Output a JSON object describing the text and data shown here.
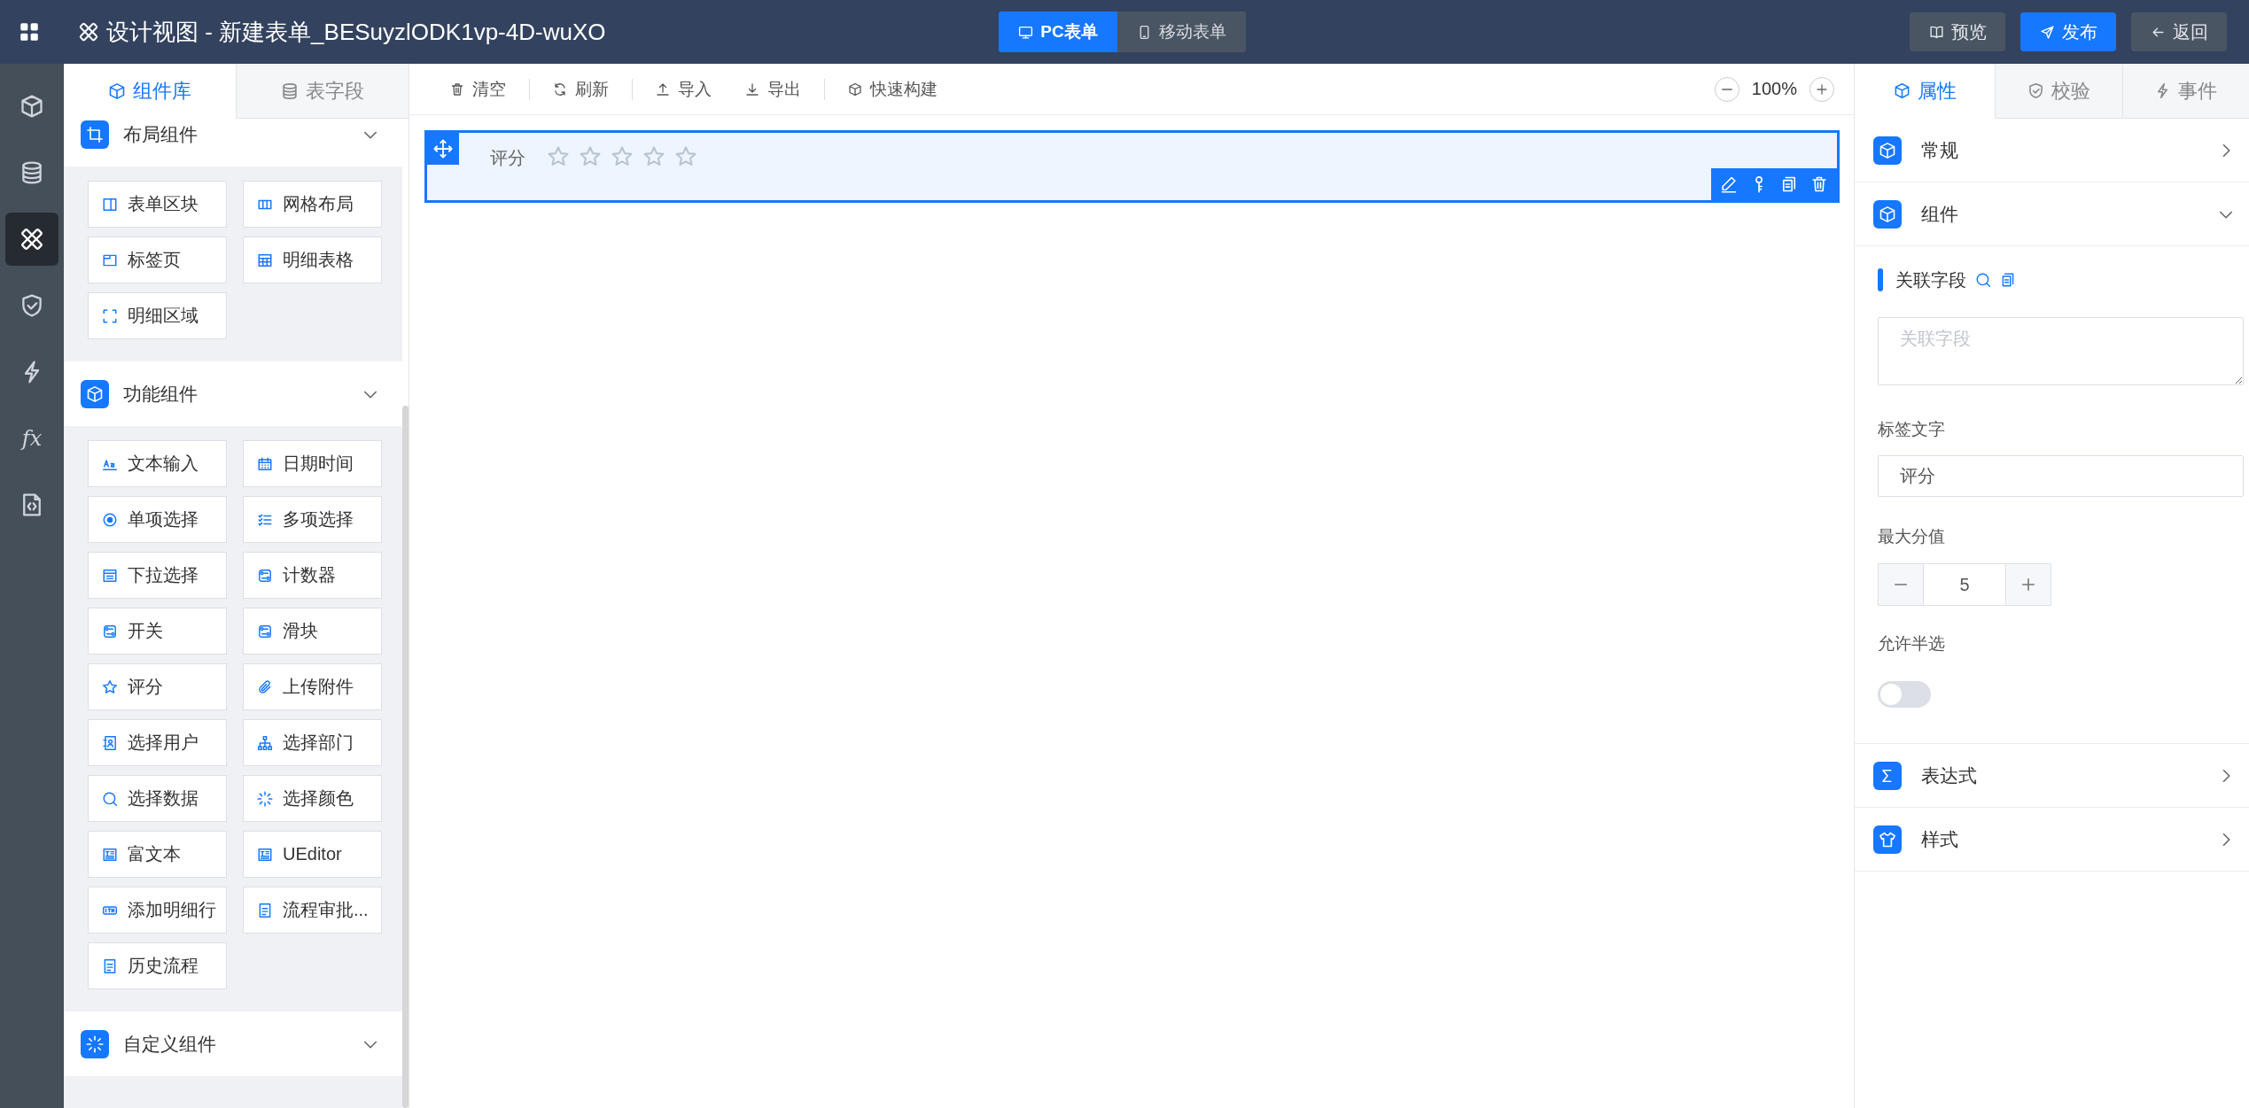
{
  "top_bar": {
    "title": "设计视图 - 新建表单_BESuyzlODK1vp-4D-wuXO",
    "mode_tabs": [
      {
        "label": "PC表单",
        "selected": true
      },
      {
        "label": "移动表单",
        "selected": false
      }
    ],
    "actions": [
      {
        "label": "预览",
        "kind": "secondary"
      },
      {
        "label": "发布",
        "kind": "primary"
      },
      {
        "label": "返回",
        "kind": "secondary"
      }
    ]
  },
  "rail": [
    {
      "selected": false
    },
    {
      "selected": false
    },
    {
      "selected": true
    },
    {
      "selected": false
    },
    {
      "selected": false
    },
    {
      "selected": false,
      "glyph": "fx"
    },
    {
      "selected": false
    }
  ],
  "left_panel": {
    "tabs": [
      {
        "label": "组件库",
        "selected": true
      },
      {
        "label": "表字段",
        "selected": false
      }
    ],
    "sections": [
      {
        "title": "布局组件",
        "expanded": true,
        "items": [
          "表单区块",
          "网格布局",
          "标签页",
          "明细表格",
          "明细区域"
        ]
      },
      {
        "title": "功能组件",
        "expanded": true,
        "items": [
          "文本输入",
          "日期时间",
          "单项选择",
          "多项选择",
          "下拉选择",
          "计数器",
          "开关",
          "滑块",
          "评分",
          "上传附件",
          "选择用户",
          "选择部门",
          "选择数据",
          "选择颜色",
          "富文本",
          "UEditor",
          "添加明细行",
          "流程审批...",
          "历史流程"
        ]
      },
      {
        "title": "自定义组件",
        "expanded": true
      }
    ]
  },
  "toolbar": {
    "actions": [
      "清空",
      "刷新",
      "导入",
      "导出",
      "快速构建"
    ],
    "zoom": "100%"
  },
  "canvas": {
    "fields": [
      {
        "label": "评分",
        "stars": 0,
        "selected": true
      }
    ]
  },
  "right_panel": {
    "tabs": [
      {
        "label": "属性",
        "selected": true
      },
      {
        "label": "校验",
        "selected": false
      },
      {
        "label": "事件",
        "selected": false
      }
    ],
    "groups": [
      {
        "title": "常规",
        "expanded": false
      },
      {
        "title": "组件",
        "expanded": true,
        "linked_field": {
          "label": "关联字段",
          "placeholder": "关联字段"
        },
        "label_text": {
          "label": "标签文字",
          "value": "评分"
        },
        "max_score": {
          "label": "最大分值",
          "value": "5"
        },
        "half_select": {
          "label": "允许半选",
          "on": false
        }
      },
      {
        "title": "表达式",
        "expanded": false
      },
      {
        "title": "样式",
        "expanded": false
      }
    ]
  }
}
